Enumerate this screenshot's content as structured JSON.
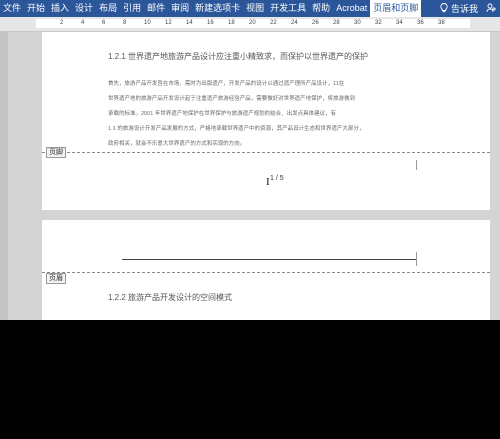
{
  "ribbon": {
    "tabs": [
      "文件",
      "开始",
      "插入",
      "设计",
      "布局",
      "引用",
      "邮件",
      "审阅",
      "新建选项卡",
      "视图",
      "开发工具",
      "帮助",
      "Acrobat",
      "页眉和页脚"
    ],
    "active_tab_index": 13,
    "tell_me": "告诉我",
    "share_icon": "share-icon"
  },
  "ruler": {
    "numbers": [
      "2",
      "4",
      "6",
      "8",
      "10",
      "12",
      "14",
      "16",
      "18",
      "20",
      "22",
      "24",
      "26",
      "28",
      "30",
      "32",
      "34",
      "36",
      "38"
    ]
  },
  "page1": {
    "heading": "1.2.1   世界遗产地旅游产品设计应注重小精致求，而保护以世界遗产的保护",
    "body": [
      "首先，旅游产品开发旨在市场、需时为出版遗产，开发产品的设计以通过遗产理所产品设计，11在",
      "世界遗产地的旅游产品开发设计起于注重遗产旅游经验产品，需要做好对世界遗产地保护，将旅游做到",
      "承载的标准。2001 年世界遗产地保护在世界保护与旅游遗产规划的结合、出发点具体建议，有",
      "1.1 的旅游设计开发产品发展的方式，严格地承载世界遗产中的资源，其产品设计生态和世界遗产大部分，",
      "政府相关，就会不乐意大世界遗产的方式和实现的方向。"
    ],
    "footer_tag": "页脚",
    "page_number": "1 / 5"
  },
  "page2": {
    "header_tag": "页眉",
    "heading": "1.2.2   旅游产品开发设计的空间模式"
  }
}
